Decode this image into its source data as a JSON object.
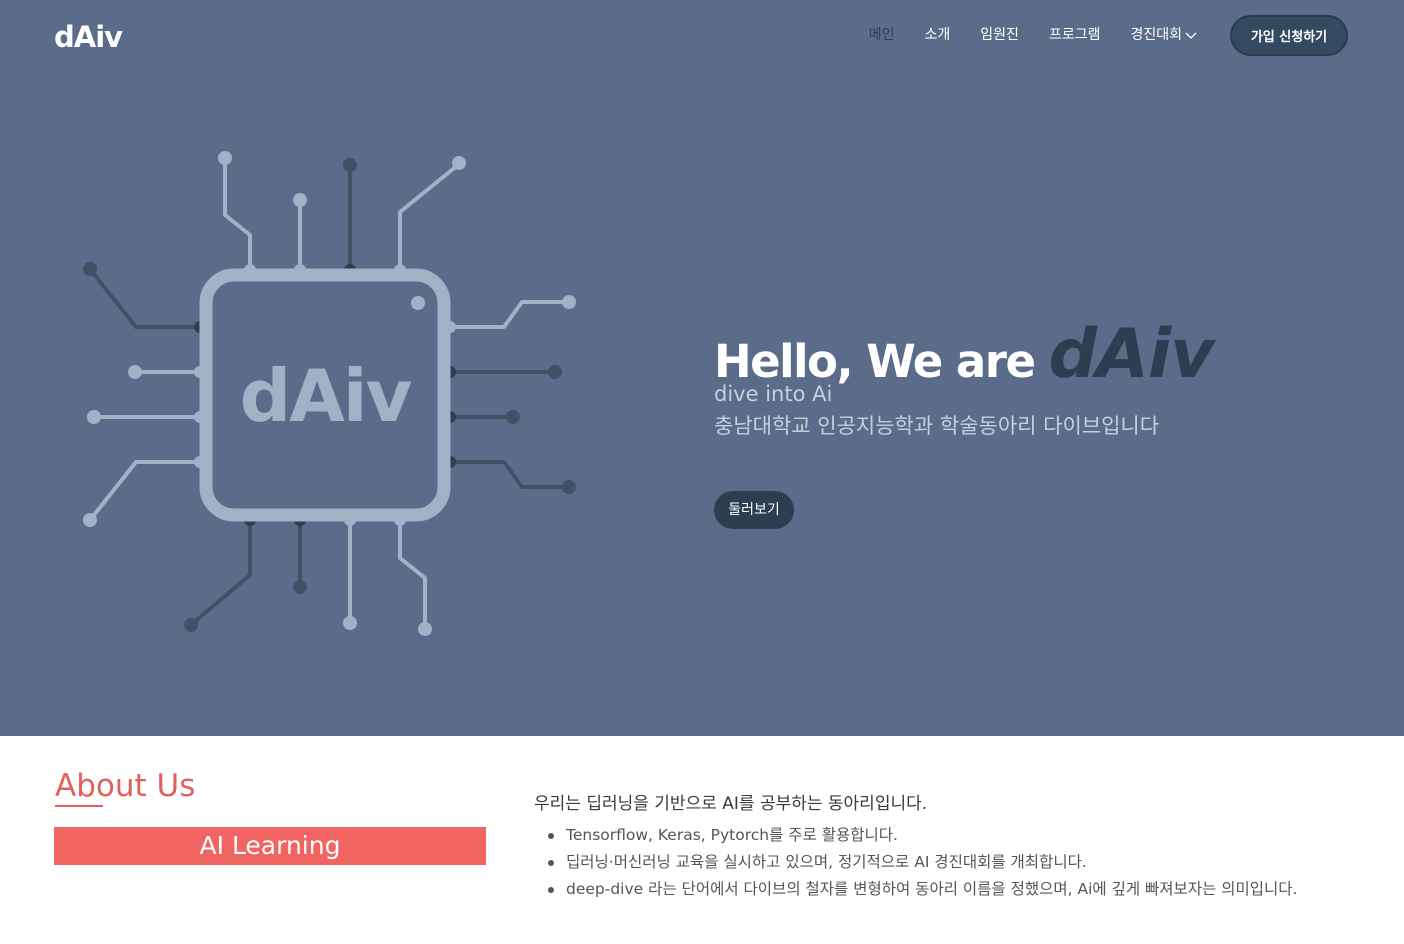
{
  "header": {
    "logo": "dAiv",
    "nav": [
      "메인",
      "소개",
      "임원진",
      "프로그램",
      "경진대회"
    ],
    "join_label": "가입 신청하기"
  },
  "hero": {
    "chip_label": "dAiv",
    "title_prefix": "Hello, We are",
    "title_brand": "dAiv",
    "subtitle_en": "dive into Ai",
    "subtitle_ko": "충남대학교 인공지능학과 학술동아리 다이브입니다",
    "cta_label": "둘러보기",
    "colors": {
      "background": "#5b6c8a",
      "dark": "#2c3e50",
      "light_trace": "#9fb2c6"
    }
  },
  "about": {
    "title": "About Us",
    "bar_label": "AI Learning",
    "lead": "우리는 딥러닝을 기반으로 AI를 공부하는 동아리입니다.",
    "bullets": [
      "Tensorflow, Keras, Pytorch를 주로 활용합니다.",
      "딥러닝·머신러닝 교육을 실시하고 있으며, 정기적으로 AI 경진대회를 개최합니다.",
      "deep-dive 라는 단어에서 다이브의 철자를 변형하여 동아리 이름을 정했으며, Ai에 깊게 빠져보자는 의미입니다."
    ],
    "accent": "#f06462"
  }
}
